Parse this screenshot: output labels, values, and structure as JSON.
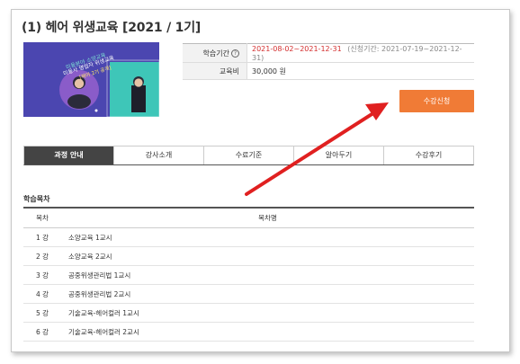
{
  "course": {
    "title": "(1) 헤어 위생교육 [2021 / 1기]"
  },
  "thumbnail": {
    "lines": [
      "미용분야 소양교육",
      "미용사 영업자 위생교육",
      "[헤어 2기 공개]"
    ]
  },
  "info": {
    "period_label": "학습기간",
    "period_help": "?",
    "period_value": "2021-08-02~2021-12-31",
    "period_note": "(신청기간: 2021-07-19~2021-12-31)",
    "fee_label": "교육비",
    "fee_value": "30,000 원"
  },
  "enroll_button": "수강신청",
  "tabs": [
    {
      "label": "과정 안내",
      "active": true
    },
    {
      "label": "강사소개"
    },
    {
      "label": "수료기준"
    },
    {
      "label": "알아두기"
    },
    {
      "label": "수강후기"
    }
  ],
  "toc": {
    "heading": "학습목차",
    "col_num": "목차",
    "col_title": "목차명",
    "rows": [
      {
        "num": "1 강",
        "title": "소양교육 1교시"
      },
      {
        "num": "2 강",
        "title": "소양교육 2교시"
      },
      {
        "num": "3 강",
        "title": "공중위생관리법 1교시"
      },
      {
        "num": "4 강",
        "title": "공중위생관리법 2교시"
      },
      {
        "num": "5 강",
        "title": "기술교육-헤어컬러 1교시"
      },
      {
        "num": "6 강",
        "title": "기술교육-헤어컬러 2교시"
      }
    ]
  },
  "colors": {
    "accent": "#f07b36",
    "annotation_arrow": "#e02020",
    "period_text": "#d32f2f",
    "active_tab": "#444444"
  }
}
